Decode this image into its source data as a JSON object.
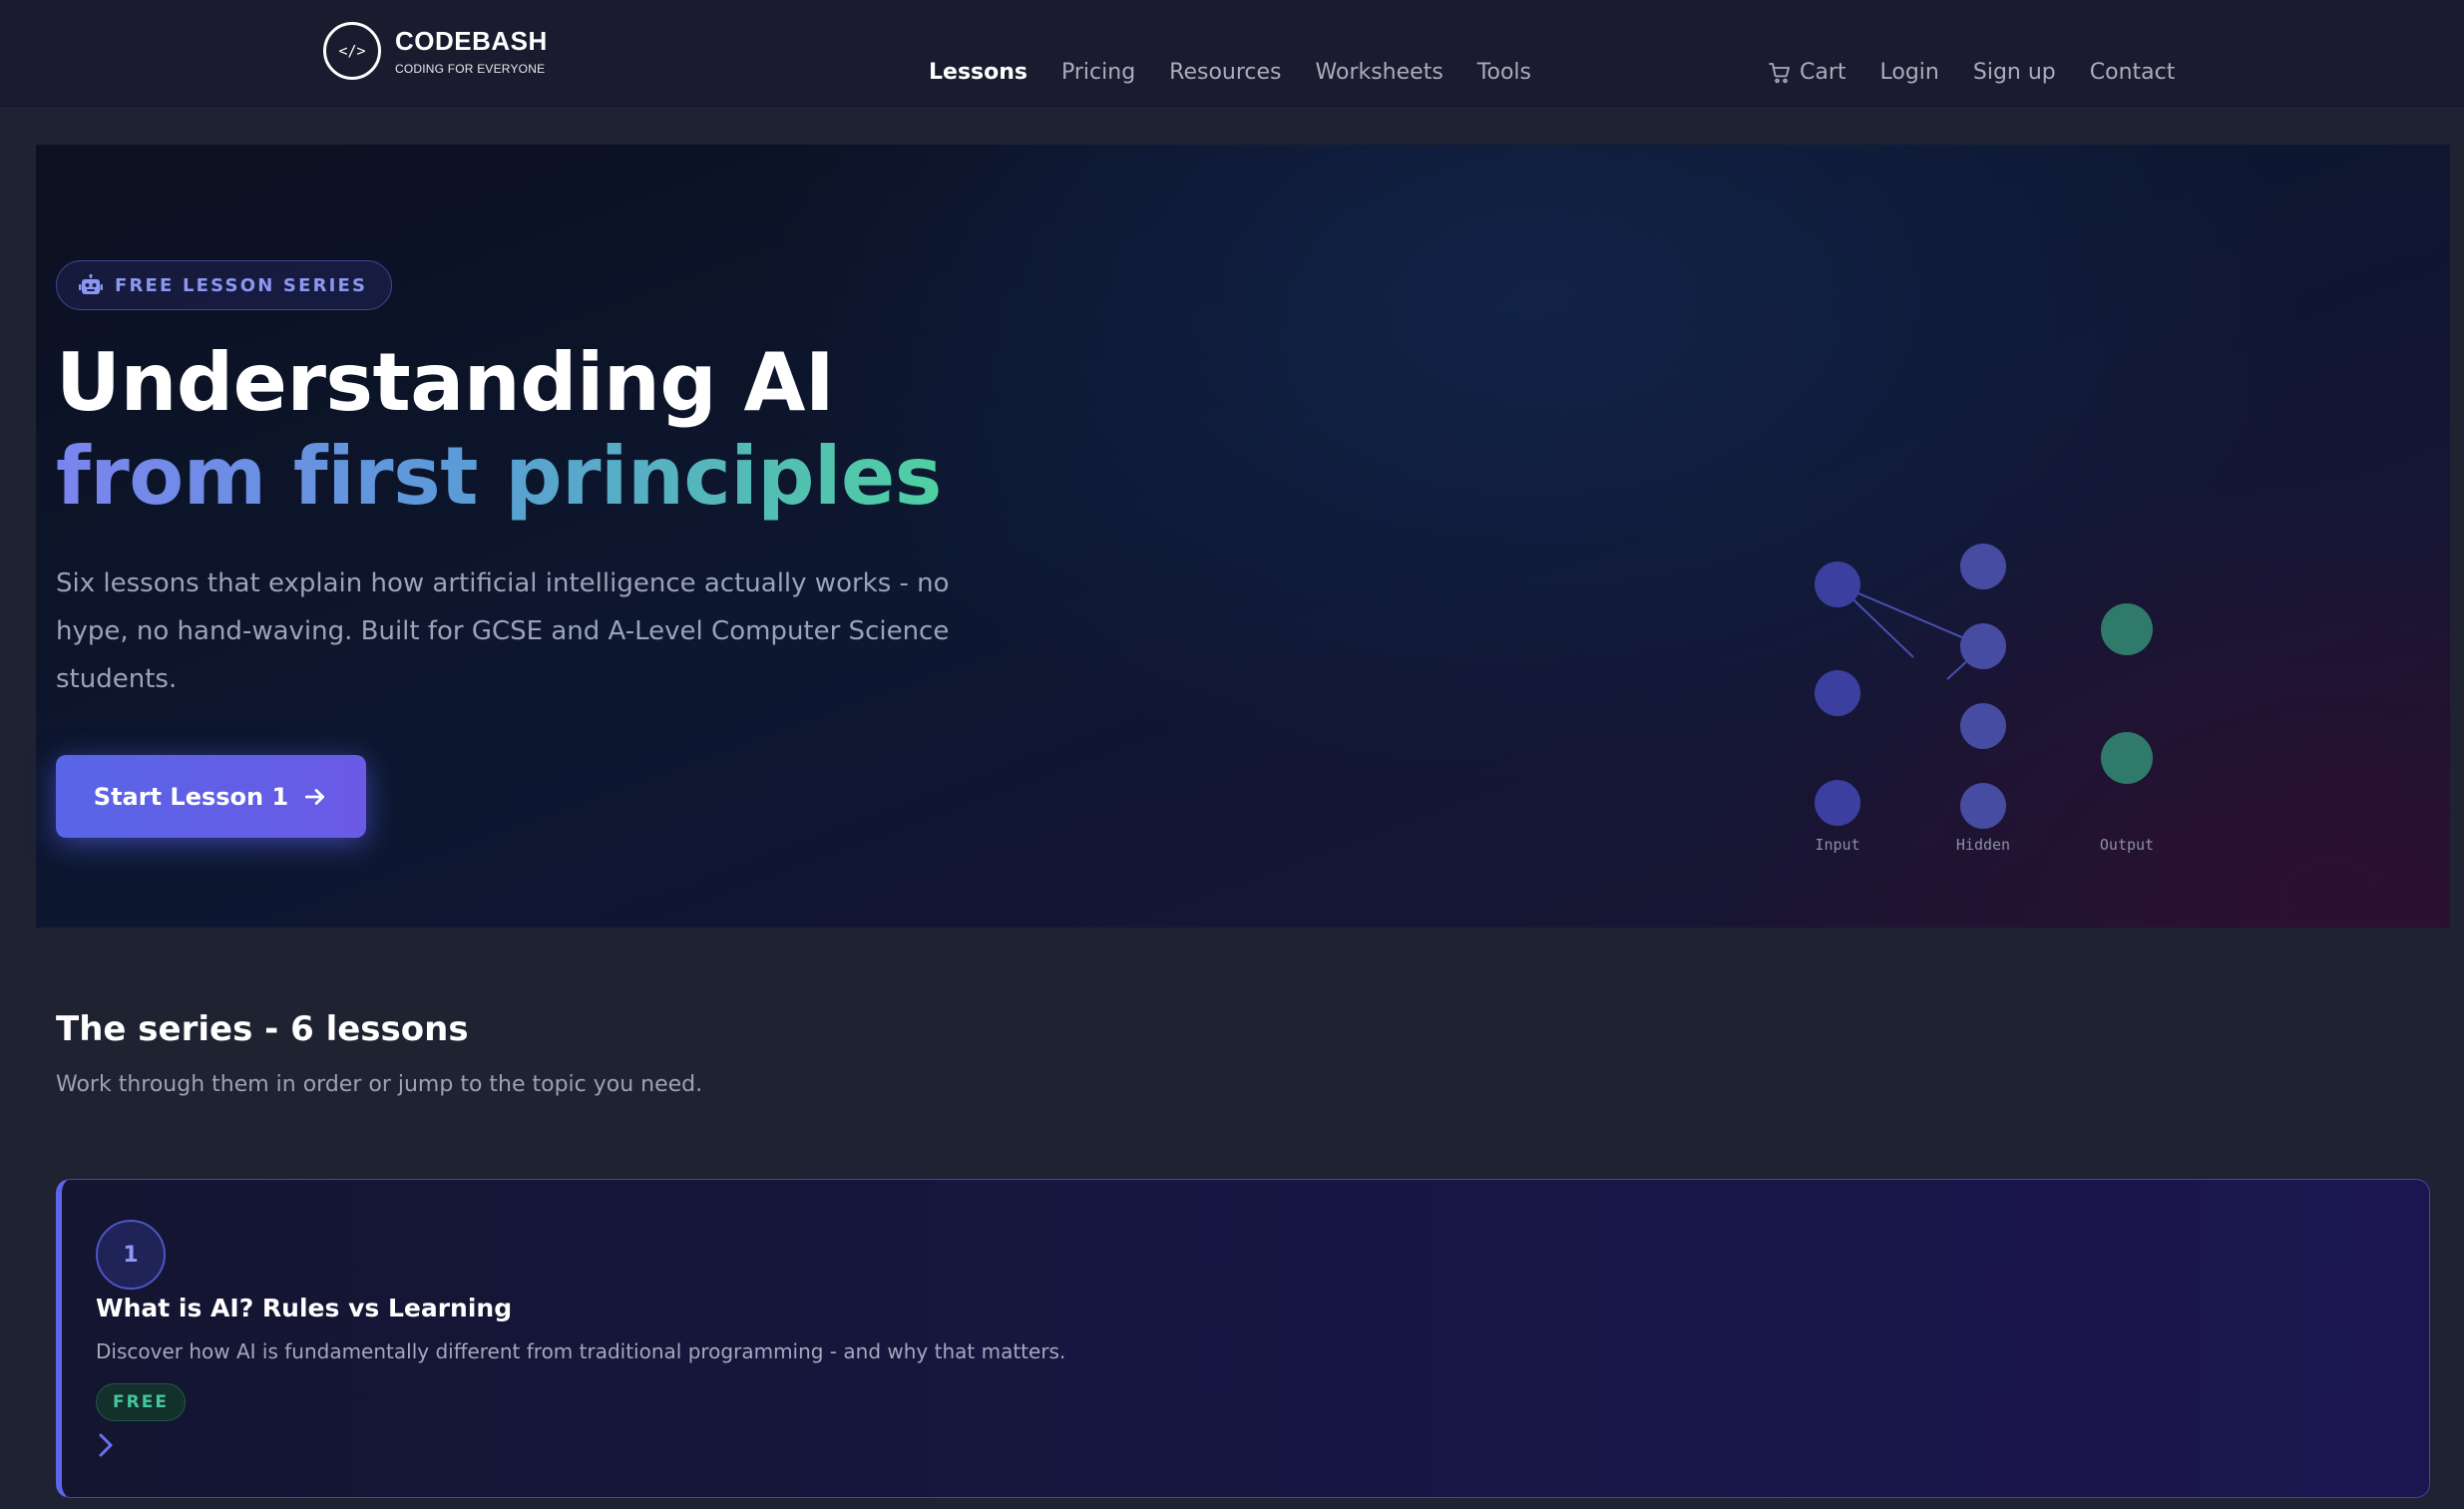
{
  "header": {
    "logo_glyph": "</>",
    "brand": "CODEBASH",
    "tagline": "CODING FOR EVERYONE",
    "nav": [
      {
        "label": "Lessons",
        "active": true
      },
      {
        "label": "Pricing"
      },
      {
        "label": "Resources"
      },
      {
        "label": "Worksheets"
      },
      {
        "label": "Tools"
      }
    ],
    "right_nav": {
      "cart": "Cart",
      "login": "Login",
      "signup": "Sign up",
      "contact": "Contact"
    }
  },
  "hero": {
    "badge": "FREE LESSON SERIES",
    "badge_icon": "robot-icon",
    "title_line1": "Understanding AI",
    "title_line2": "from first principles",
    "description": "Six lessons that explain how artificial intelligence actually works - no hype, no hand-waving. Built for GCSE and A-Level Computer Science students.",
    "cta": "Start Lesson 1",
    "cta_icon": "arrow-right-icon",
    "network_labels": {
      "input": "Input",
      "hidden": "Hidden",
      "output": "Output"
    }
  },
  "series": {
    "title": "The series - 6 lessons",
    "subtitle": "Work through them in order or jump to the topic you need.",
    "lessons": [
      {
        "number": "1",
        "title": "What is AI? Rules vs Learning",
        "description": "Discover how AI is fundamentally different from traditional programming - and why that matters.",
        "tag": "FREE"
      }
    ]
  },
  "colors": {
    "accent": "#5d66e8",
    "output_node": "#2f7a6a",
    "free_green": "#43c79a",
    "background": "#1e2231"
  }
}
